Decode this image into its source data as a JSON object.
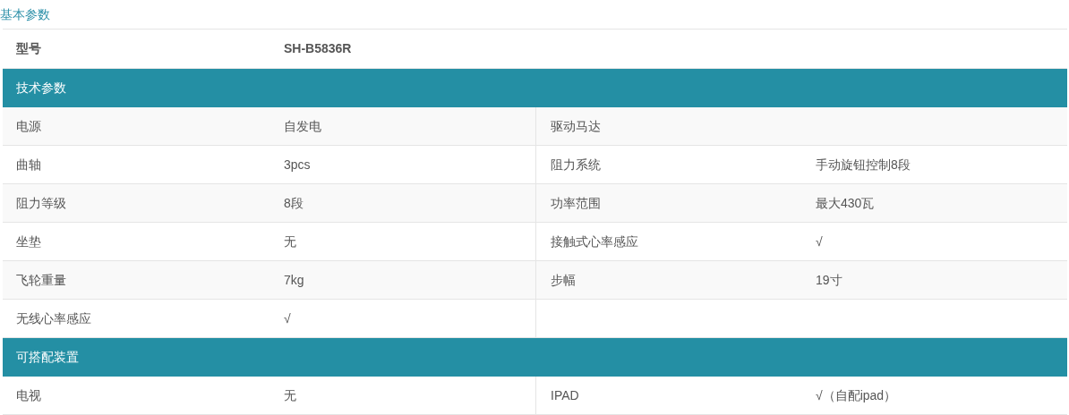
{
  "title": "基本参数",
  "model": {
    "label": "型号",
    "value": "SH-B5836R"
  },
  "sections": [
    {
      "title": "技术参数",
      "rows": [
        {
          "cells": [
            "电源",
            "自发电",
            "驱动马达"
          ]
        },
        {
          "cells": [
            "曲轴",
            "3pcs",
            "阻力系统",
            "手动旋钮控制8段"
          ]
        },
        {
          "cells": [
            "阻力等级",
            "8段",
            "功率范围",
            "最大430瓦"
          ]
        },
        {
          "cells": [
            "坐垫",
            "无",
            "接触式心率感应",
            "√"
          ]
        },
        {
          "cells": [
            "飞轮重量",
            "7kg",
            "步幅",
            "19寸"
          ]
        },
        {
          "cells": [
            "无线心率感应",
            "√"
          ]
        }
      ]
    },
    {
      "title": "可搭配装置",
      "rows": [
        {
          "cells": [
            "电视",
            "无",
            "IPAD",
            "√（自配ipad）"
          ]
        }
      ]
    }
  ]
}
